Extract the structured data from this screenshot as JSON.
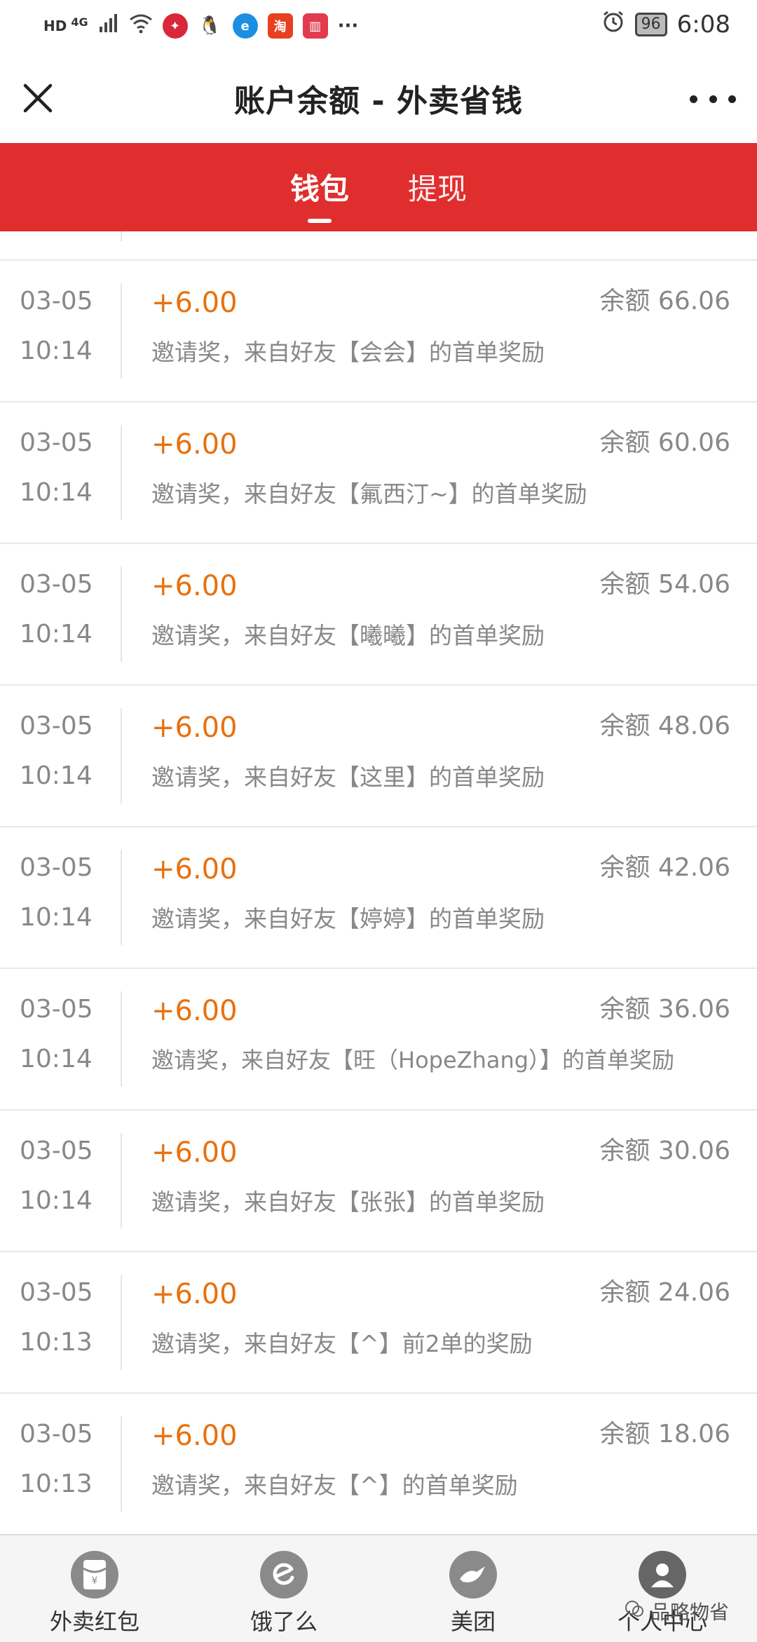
{
  "status_bar": {
    "hd_label": "HD",
    "network_label": "4G",
    "more_indicator": "···",
    "battery": "96",
    "time": "6:08",
    "icons": [
      "signal-icon",
      "wifi-icon",
      "app-notification-icon",
      "qq-icon",
      "browser-icon",
      "shop-icon",
      "book-icon",
      "alarm-icon",
      "battery-icon"
    ]
  },
  "header": {
    "title": "账户余额 - 外卖省钱",
    "close_icon": "close-icon",
    "more_icon": "more-icon"
  },
  "tabs": [
    {
      "label": "钱包",
      "active": true
    },
    {
      "label": "提现",
      "active": false
    }
  ],
  "transactions": [
    {
      "date": "03-05",
      "time": "10:14",
      "amount": "+6.00",
      "balance": "余额 66.06",
      "description": "邀请奖，来自好友【会会】的首单奖励"
    },
    {
      "date": "03-05",
      "time": "10:14",
      "amount": "+6.00",
      "balance": "余额 60.06",
      "description": "邀请奖，来自好友【氟西汀~】的首单奖励"
    },
    {
      "date": "03-05",
      "time": "10:14",
      "amount": "+6.00",
      "balance": "余额 54.06",
      "description": "邀请奖，来自好友【曦曦】的首单奖励"
    },
    {
      "date": "03-05",
      "time": "10:14",
      "amount": "+6.00",
      "balance": "余额 48.06",
      "description": "邀请奖，来自好友【这里】的首单奖励"
    },
    {
      "date": "03-05",
      "time": "10:14",
      "amount": "+6.00",
      "balance": "余额 42.06",
      "description": "邀请奖，来自好友【婷婷】的首单奖励"
    },
    {
      "date": "03-05",
      "time": "10:14",
      "amount": "+6.00",
      "balance": "余额 36.06",
      "description": "邀请奖，来自好友【旺（HopeZhang）】的首单奖励"
    },
    {
      "date": "03-05",
      "time": "10:14",
      "amount": "+6.00",
      "balance": "余额 30.06",
      "description": "邀请奖，来自好友【张张】的首单奖励"
    },
    {
      "date": "03-05",
      "time": "10:13",
      "amount": "+6.00",
      "balance": "余额 24.06",
      "description": "邀请奖，来自好友【^】前2单的奖励"
    },
    {
      "date": "03-05",
      "time": "10:13",
      "amount": "+6.00",
      "balance": "余额 18.06",
      "description": "邀请奖，来自好友【^】的首单奖励"
    }
  ],
  "bottom_nav": [
    {
      "label": "外卖红包",
      "icon": "red-packet-icon"
    },
    {
      "label": "饿了么",
      "icon": "eleme-icon"
    },
    {
      "label": "美团",
      "icon": "meituan-icon"
    },
    {
      "label": "个人中心",
      "icon": "user-icon"
    }
  ],
  "watermark": "品略物省",
  "colors": {
    "accent_red": "#e02e2e",
    "amount_orange": "#e8710e",
    "muted_text": "#888888"
  }
}
